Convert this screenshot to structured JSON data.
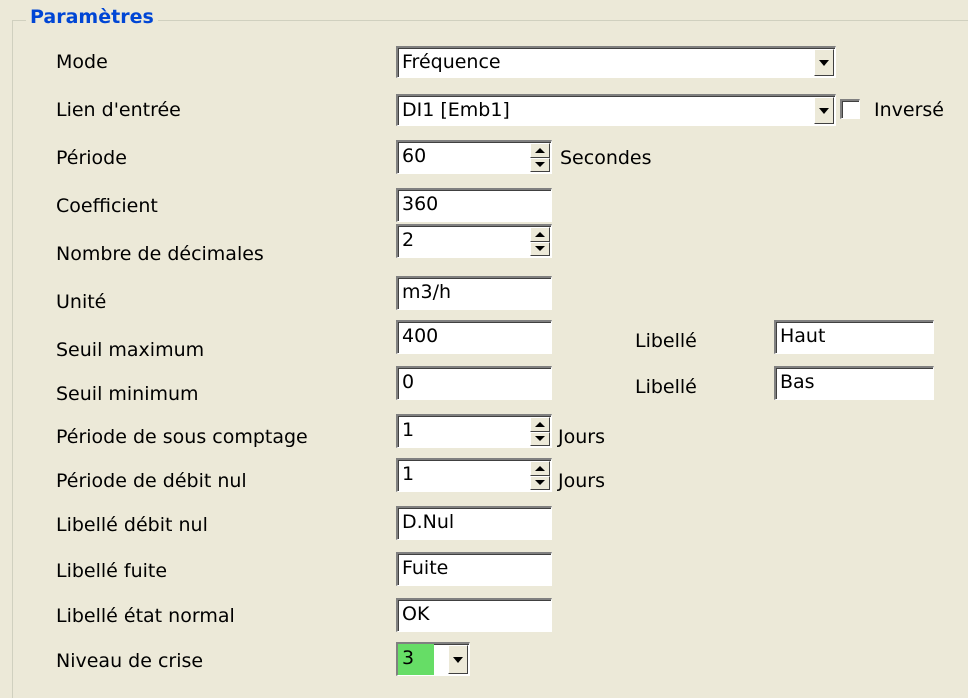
{
  "group": {
    "title": "Paramètres"
  },
  "fields": {
    "mode": {
      "label": "Mode",
      "value": "Fréquence"
    },
    "input_link": {
      "label": "Lien d'entrée",
      "value": "DI1 [Emb1]",
      "invert_label": "Inversé",
      "invert_checked": false
    },
    "period": {
      "label": "Période",
      "value": "60",
      "unit": "Secondes"
    },
    "coefficient": {
      "label": "Coefficient",
      "value": "360"
    },
    "decimals": {
      "label": "Nombre de décimales",
      "value": "2"
    },
    "unit": {
      "label": "Unité",
      "value": "m3/h"
    },
    "max_threshold": {
      "label": "Seuil maximum",
      "value": "400",
      "tag_label": "Libellé",
      "tag_value": "Haut"
    },
    "min_threshold": {
      "label": "Seuil minimum",
      "value": "0",
      "tag_label": "Libellé",
      "tag_value": "Bas"
    },
    "undercount_period": {
      "label": "Période de sous comptage",
      "value": "1",
      "unit": "Jours"
    },
    "zero_flow_period": {
      "label": "Période de débit nul",
      "value": "1",
      "unit": "Jours"
    },
    "zero_flow_label": {
      "label": "Libellé débit nul",
      "value": "D.Nul"
    },
    "leak_label": {
      "label": "Libellé fuite",
      "value": "Fuite"
    },
    "normal_label": {
      "label": "Libellé état normal",
      "value": "OK"
    },
    "crisis_level": {
      "label": "Niveau de crise",
      "value": "3",
      "value_bg": "#66dd66"
    }
  },
  "colors": {
    "title": "#0046d5",
    "background": "#ece9d8"
  },
  "icons": {
    "dropdown": "chevron-down-icon",
    "spin": "spin-arrows-icon"
  }
}
